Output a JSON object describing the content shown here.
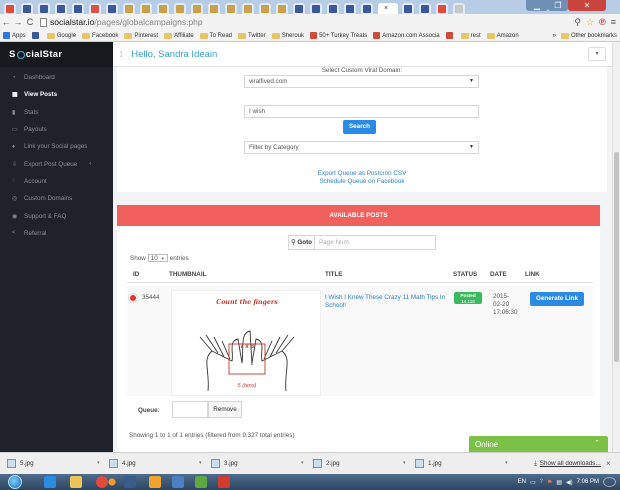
{
  "browser": {
    "url_host": "socialstar.io",
    "url_path": "/pages/globalcampaigns.php",
    "bookmarks": [
      {
        "label": "Apps",
        "kind": "apps"
      },
      {
        "label": "",
        "kind": "facebook"
      },
      {
        "label": "Google",
        "kind": "folder"
      },
      {
        "label": "Facebook",
        "kind": "folder"
      },
      {
        "label": "Pinterest",
        "kind": "folder"
      },
      {
        "label": "Affiliate",
        "kind": "folder"
      },
      {
        "label": "To Read",
        "kind": "folder"
      },
      {
        "label": "Twitter",
        "kind": "folder"
      },
      {
        "label": "Sherouk",
        "kind": "folder"
      },
      {
        "label": "50+ Turkey Treats",
        "kind": "site"
      },
      {
        "label": "Amazon.com Associa",
        "kind": "site"
      },
      {
        "label": "",
        "kind": "site"
      },
      {
        "label": "rest",
        "kind": "folder"
      },
      {
        "label": "Amazon",
        "kind": "folder"
      }
    ],
    "other_bookmarks": "Other bookmarks",
    "more_bookmarks": "»"
  },
  "sidebar": {
    "brand_before": "S",
    "brand_after": "cialStar",
    "items": [
      {
        "label": "Dashboard",
        "icon": "dashboard-icon",
        "glyph": "◔"
      },
      {
        "label": "View Posts",
        "icon": "grid-icon",
        "glyph": "▦",
        "active": true
      },
      {
        "label": "Stats",
        "icon": "stats-icon",
        "glyph": "▮"
      },
      {
        "label": "Payouts",
        "icon": "card-icon",
        "glyph": "▭"
      },
      {
        "label": "Link your Social pages",
        "icon": "thumb-icon",
        "glyph": "♦"
      },
      {
        "label": "Export Post Queue",
        "icon": "export-icon",
        "glyph": "⇩",
        "caret": "‹"
      },
      {
        "label": "Account",
        "icon": "account-icon",
        "glyph": "◌"
      },
      {
        "label": "Custom Domains",
        "icon": "globe-icon",
        "glyph": "◎"
      },
      {
        "label": "Support & FAQ",
        "icon": "support-icon",
        "glyph": "◉"
      },
      {
        "label": "Referral",
        "icon": "share-icon",
        "glyph": "<"
      }
    ]
  },
  "header": {
    "greeting": "Hello, Sandra Ideain",
    "menu_glyph": "⁞",
    "dropdown_glyph": "▾"
  },
  "filters": {
    "domain_label": "Select Custom Viral Domain:",
    "domain_value": "viralfived.com",
    "search_value": "I wish",
    "search_button": "Search",
    "category_value": "Filter by Category",
    "export_link": "Export Queue as Postcron CSV",
    "schedule_link": "Schedule Queue on Facebook"
  },
  "posts": {
    "banner": "AVAILABLE POSTS",
    "goto_button": "Goto",
    "page_placeholder": "Page Num.",
    "show_prefix": "Show",
    "show_value": "10",
    "show_suffix": "entries",
    "columns": [
      "ID",
      "THUMBNAIL",
      "TITLE",
      "STATUS",
      "DATE",
      "LINK"
    ],
    "row": {
      "id": "35444",
      "thumbnail_caption": "Count the fingers",
      "thumbnail_equation": "7 x 8",
      "thumbnail_tens": "5 (tens)",
      "title": "I Wish I Knew These Crazy 11 Math Tips In School!",
      "status_line1": "Posted",
      "status_line2": "14,118",
      "date_line1": "2015-",
      "date_line2": "02-20",
      "date_line3": "17:06:30",
      "link_button": "Generate Link"
    },
    "queue_label": "Queue:",
    "remove_button": "Remove",
    "summary": "Showing 1 to 1 of 1 entries (filtered from 9,327 total entries)"
  },
  "chat": {
    "label": "Online"
  },
  "downloads": {
    "files": [
      "5.jpg",
      "4.jpg",
      "3.jpg",
      "2.jpg",
      "1.jpg"
    ],
    "show_all": "Show all downloads...",
    "close": "×"
  },
  "taskbar": {
    "lang": "EN",
    "time": "7:06 PM"
  },
  "colors": {
    "sidebar_bg": "#1f2228",
    "accent_blue": "#2a8ae5",
    "banner_red": "#f0605c",
    "status_green": "#3cb95f",
    "chat_green": "#7bc148"
  }
}
